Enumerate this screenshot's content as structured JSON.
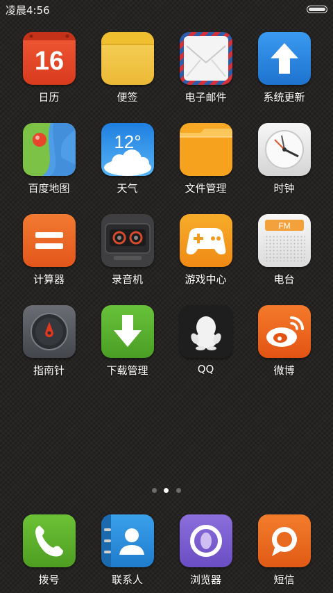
{
  "status_bar": {
    "time": "凌晨4:56",
    "battery_level": 1.0
  },
  "apps": [
    {
      "id": "calendar",
      "label": "日历",
      "icon": "calendar-icon",
      "badge_text": "16",
      "color": "#e8472b"
    },
    {
      "id": "notes",
      "label": "便签",
      "icon": "notes-icon",
      "color": "#f2c94c"
    },
    {
      "id": "email",
      "label": "电子邮件",
      "icon": "email-icon",
      "color": "#ffffff"
    },
    {
      "id": "updater",
      "label": "系统更新",
      "icon": "update-arrow-icon",
      "color": "#2d8ce4"
    },
    {
      "id": "maps",
      "label": "百度地图",
      "icon": "map-icon",
      "color": "#6fc13f"
    },
    {
      "id": "weather",
      "label": "天气",
      "icon": "weather-icon",
      "badge_text": "12°",
      "color": "#2e8fe6"
    },
    {
      "id": "files",
      "label": "文件管理",
      "icon": "folder-icon",
      "color": "#f6a623"
    },
    {
      "id": "clock",
      "label": "时钟",
      "icon": "clock-icon",
      "color": "#e6e6e6"
    },
    {
      "id": "calculator",
      "label": "计算器",
      "icon": "calculator-icon",
      "color": "#ef6a24"
    },
    {
      "id": "recorder",
      "label": "录音机",
      "icon": "cassette-icon",
      "color": "#4a4a4a"
    },
    {
      "id": "games",
      "label": "游戏中心",
      "icon": "gamepad-icon",
      "color": "#f39a1d"
    },
    {
      "id": "radio",
      "label": "电台",
      "icon": "radio-icon",
      "badge_text": "FM",
      "color": "#efefef"
    },
    {
      "id": "compass",
      "label": "指南针",
      "icon": "compass-icon",
      "color": "#5a5d63"
    },
    {
      "id": "downloads",
      "label": "下载管理",
      "icon": "download-arrow-icon",
      "color": "#58b02f"
    },
    {
      "id": "qq",
      "label": "QQ",
      "icon": "qq-penguin-icon",
      "color": "#1c1c1c"
    },
    {
      "id": "weibo",
      "label": "微博",
      "icon": "weibo-icon",
      "color": "#ee6b1e"
    }
  ],
  "pager": {
    "pages": 3,
    "current": 2
  },
  "dock": [
    {
      "id": "phone",
      "label": "拨号",
      "icon": "phone-icon",
      "color": "#5fb22d"
    },
    {
      "id": "contacts",
      "label": "联系人",
      "icon": "contacts-icon",
      "color": "#2c8fdc"
    },
    {
      "id": "browser",
      "label": "浏览器",
      "icon": "browser-icon",
      "color": "#7d5fd1"
    },
    {
      "id": "messages",
      "label": "短信",
      "icon": "message-icon",
      "color": "#ef6f23"
    }
  ]
}
